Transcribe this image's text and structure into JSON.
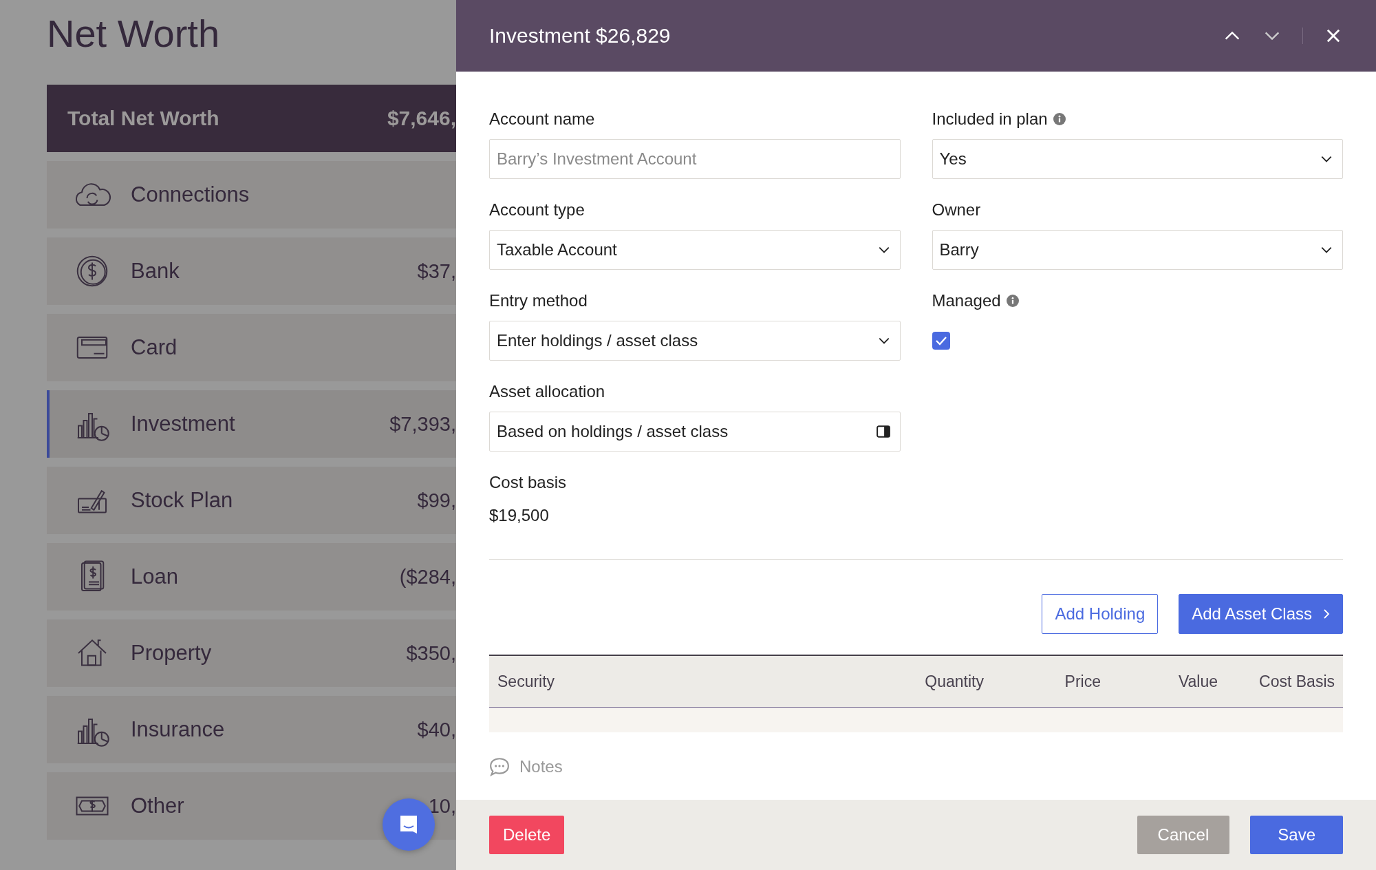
{
  "sidebar": {
    "title": "Net Worth",
    "total": {
      "label": "Total Net Worth",
      "value": "$7,646,"
    },
    "items": [
      {
        "kind": "connections",
        "label": "Connections",
        "selected": false
      },
      {
        "kind": "bank",
        "label": "Bank",
        "value": "$37,",
        "selected": false
      },
      {
        "kind": "card",
        "label": "Card",
        "selected": false
      },
      {
        "kind": "investment",
        "label": "Investment",
        "value": "$7,393,",
        "selected": true
      },
      {
        "kind": "stock",
        "label": "Stock Plan",
        "value": "$99,",
        "selected": false
      },
      {
        "kind": "loan",
        "label": "Loan",
        "value": "($284,",
        "selected": false
      },
      {
        "kind": "property",
        "label": "Property",
        "value": "$350,",
        "selected": false
      },
      {
        "kind": "insurance",
        "label": "Insurance",
        "value": "$40,",
        "selected": false
      },
      {
        "kind": "other",
        "label": "Other",
        "value": "10,",
        "selected": false
      }
    ]
  },
  "drawer": {
    "title": "Investment $26,829",
    "left_fields": [
      {
        "kind": "text",
        "label": "Account name",
        "placeholder": "Barry’s Investment Account"
      },
      {
        "kind": "select",
        "label": "Account type",
        "value": "Taxable Account"
      },
      {
        "kind": "select",
        "label": "Entry method",
        "value": "Enter holdings / asset class"
      },
      {
        "kind": "panel",
        "label": "Asset allocation",
        "value": "Based on holdings / asset class"
      },
      {
        "kind": "static",
        "label": "Cost basis",
        "value": "$19,500"
      }
    ],
    "right_fields": [
      {
        "kind": "select",
        "label": "Included in plan",
        "info": true,
        "value": "Yes"
      },
      {
        "kind": "select",
        "label": "Owner",
        "info": false,
        "value": "Barry"
      },
      {
        "kind": "checkbox",
        "label": "Managed",
        "info": true,
        "checked": true
      }
    ],
    "buttons": [
      {
        "kind": "outline",
        "label": "Add Holding"
      },
      {
        "kind": "primary",
        "label": "Add Asset Class",
        "chevron": true
      }
    ],
    "table": {
      "columns": [
        "Security",
        "Quantity",
        "Price",
        "Value",
        "Cost Basis"
      ]
    },
    "notes": "Notes",
    "footer": {
      "delete": "Delete",
      "cancel": "Cancel",
      "save": "Save"
    }
  }
}
